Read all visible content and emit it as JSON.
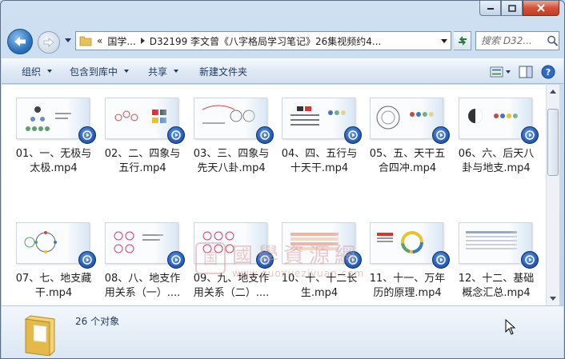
{
  "window": {
    "caption_buttons": [
      "minimize",
      "maximize",
      "close"
    ]
  },
  "address_bar": {
    "overflow_marker": "«",
    "crumbs": [
      "国学...",
      "D32199 李文曾《八字格局学习笔记》26集视频约4..."
    ]
  },
  "search": {
    "placeholder": "搜索 D32..."
  },
  "toolbar": {
    "organize": "组织",
    "include_in_library": "包含到库中",
    "share": "共享",
    "new_folder": "新建文件夹"
  },
  "files": [
    {
      "name": "01、一、无极与太极.mp4",
      "line1": "01、一、无极与",
      "line2": "太极.mp4"
    },
    {
      "name": "02、二、四象与五行.mp4",
      "line1": "02、二、四象与",
      "line2": "五行.mp4"
    },
    {
      "name": "03、三、四象与先天八卦.mp4",
      "line1": "03、三、四象与",
      "line2": "先天八卦.mp4"
    },
    {
      "name": "04、四、五行与十天干.mp4",
      "line1": "04、四、五行与",
      "line2": "十天干.mp4"
    },
    {
      "name": "05、五、天干五合四冲.mp4",
      "line1": "05、五、天干五",
      "line2": "合四冲.mp4"
    },
    {
      "name": "06、六、后天八卦与地支.mp4",
      "line1": "06、六、后天八",
      "line2": "卦与地支.mp4"
    },
    {
      "name": "07、七、地支藏干.mp4",
      "line1": "07、七、地支藏",
      "line2": "干.mp4"
    },
    {
      "name": "08、八、地支作用关系（一）....",
      "line1": "08、八、地支作",
      "line2": "用关系（一）...."
    },
    {
      "name": "09、九、地支作用关系（二）....",
      "line1": "09、九、地支作",
      "line2": "用关系（二）...."
    },
    {
      "name": "10、十、十二长生.mp4",
      "line1": "10、十、十二长",
      "line2": "生.mp4"
    },
    {
      "name": "11、十一、万年历的原理.mp4",
      "line1": "11、十一、万年",
      "line2": "历的原理.mp4"
    },
    {
      "name": "12、十二、基础概念汇总.mp4",
      "line1": "12、十二、基础",
      "line2": "概念汇总.mp4"
    }
  ],
  "watermark": {
    "seal": "国",
    "title": "國學資源網",
    "url": "www.guoxueziyuan.com"
  },
  "details_pane": {
    "count": "26 个对象"
  },
  "colors": {
    "play_badge": "#2a63c0",
    "toolbar_text": "#1e395b",
    "close_button": "#c33b25"
  }
}
